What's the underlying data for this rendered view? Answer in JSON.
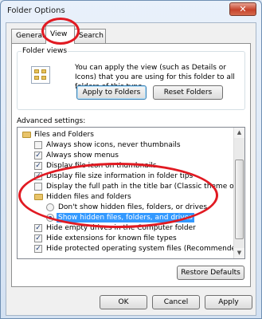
{
  "window": {
    "title": "Folder Options",
    "close_glyph": "✕"
  },
  "tabs": [
    {
      "label": "General"
    },
    {
      "label": "View"
    },
    {
      "label": "Search"
    }
  ],
  "folder_views": {
    "label": "Folder views",
    "icon": "folder-views-icon",
    "description": "You can apply the view (such as Details or Icons) that you are using for this folder to all folders of this type.",
    "apply_label": "Apply to Folders",
    "reset_label": "Reset Folders"
  },
  "advanced": {
    "label": "Advanced settings:",
    "items": [
      {
        "type": "folder",
        "label": "Files and Folders"
      },
      {
        "type": "checkbox",
        "label": "Always show icons, never thumbnails",
        "checked": false
      },
      {
        "type": "checkbox",
        "label": "Always show menus",
        "checked": true
      },
      {
        "type": "checkbox",
        "label": "Display file icon on thumbnails",
        "checked": true
      },
      {
        "type": "checkbox",
        "label": "Display file size information in folder tips",
        "checked": true
      },
      {
        "type": "checkbox",
        "label": "Display the full path in the title bar (Classic theme only)",
        "checked": false
      },
      {
        "type": "folder",
        "label": "Hidden files and folders"
      },
      {
        "type": "radio",
        "label": "Don't show hidden files, folders, or drives",
        "checked": false
      },
      {
        "type": "radio",
        "label": "Show hidden files, folders, and drives",
        "checked": true,
        "selected": true
      },
      {
        "type": "checkbox",
        "label": "Hide empty drives in the Computer folder",
        "checked": true
      },
      {
        "type": "checkbox",
        "label": "Hide extensions for known file types",
        "checked": true
      },
      {
        "type": "checkbox",
        "label": "Hide protected operating system files (Recommended)",
        "checked": true
      }
    ],
    "restore_label": "Restore Defaults"
  },
  "buttons": {
    "ok": "OK",
    "cancel": "Cancel",
    "apply": "Apply"
  },
  "colors": {
    "annotation": "#e11a22",
    "selection": "#3399ff"
  }
}
